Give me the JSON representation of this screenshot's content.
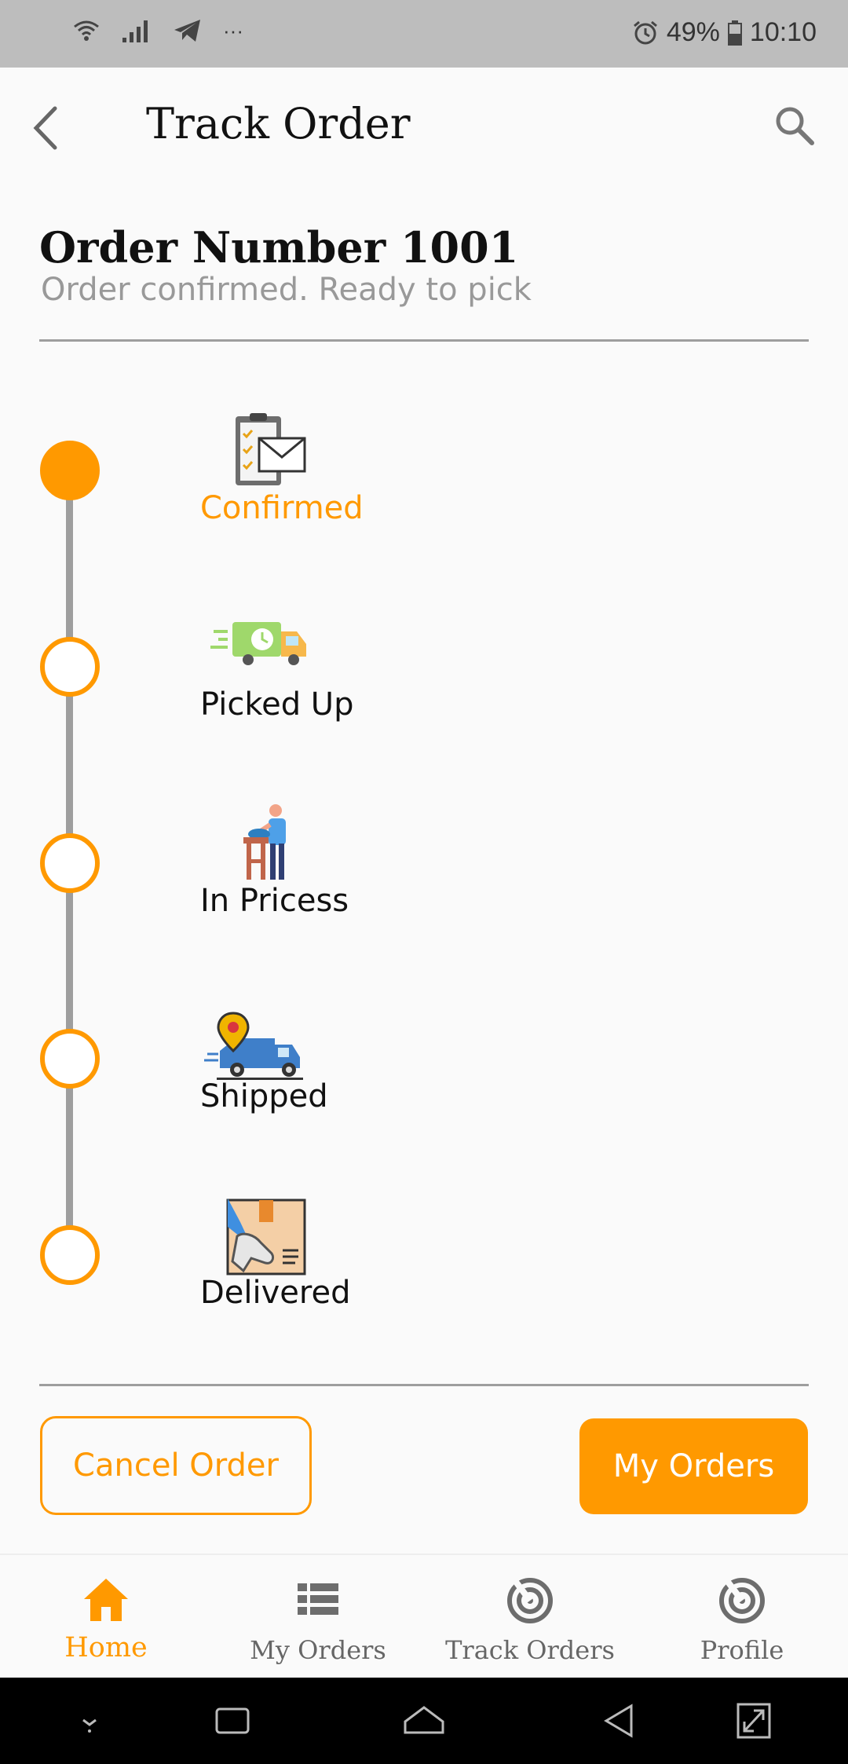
{
  "status_bar": {
    "battery": "49%",
    "time": "10:10",
    "more": "···"
  },
  "app_bar": {
    "title": "Track Order"
  },
  "order": {
    "number_label": "Order Number 1001",
    "status_text": "Order confirmed. Ready to pick"
  },
  "timeline": {
    "steps": [
      {
        "label": "Confirmed",
        "icon": "clipboard-envelope-icon",
        "active": true
      },
      {
        "label": "Picked Up",
        "icon": "delivery-truck-clock-icon",
        "active": false
      },
      {
        "label": "In Pricess",
        "icon": "person-packing-icon",
        "active": false
      },
      {
        "label": "Shipped",
        "icon": "van-location-pin-icon",
        "active": false
      },
      {
        "label": "Delivered",
        "icon": "hand-package-icon",
        "active": false
      }
    ]
  },
  "actions": {
    "cancel_label": "Cancel Order",
    "my_orders_label": "My Orders"
  },
  "bottom_nav": {
    "items": [
      {
        "label": "Home",
        "icon": "home-icon",
        "active": true
      },
      {
        "label": "My Orders",
        "icon": "list-icon",
        "active": false
      },
      {
        "label": "Track Orders",
        "icon": "target-icon",
        "active": false
      },
      {
        "label": "Profile",
        "icon": "target-icon",
        "active": false
      }
    ]
  },
  "colors": {
    "accent": "#ff9900",
    "muted": "#9e9e9e",
    "background": "#fafafa"
  }
}
